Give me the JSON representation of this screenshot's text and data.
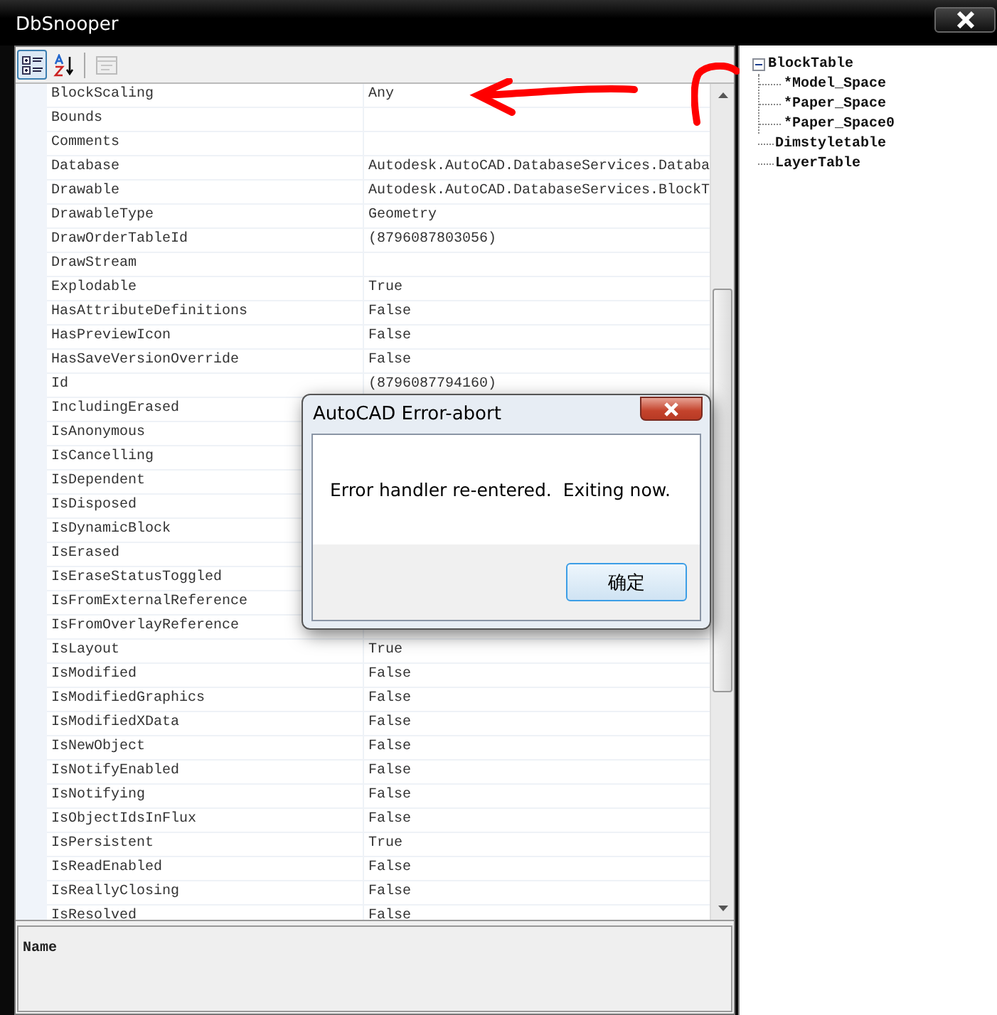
{
  "window": {
    "title": "DbSnooper"
  },
  "toolbar": [
    {
      "kind": "categorized",
      "selected": true,
      "disabled": false
    },
    {
      "kind": "alphabetical",
      "selected": false,
      "disabled": false
    },
    {
      "kind": "pages",
      "selected": false,
      "disabled": true
    }
  ],
  "properties": [
    {
      "name": "BlockScaling",
      "value": "Any"
    },
    {
      "name": "Bounds"
    },
    {
      "name": "Comments"
    },
    {
      "name": "Database",
      "value": "Autodesk.AutoCAD.DatabaseServices.Databa"
    },
    {
      "name": "Drawable",
      "value": "Autodesk.AutoCAD.DatabaseServices.BlockT"
    },
    {
      "name": "DrawableType",
      "value": "Geometry"
    },
    {
      "name": "DrawOrderTableId",
      "value": "(8796087803056)"
    },
    {
      "name": "DrawStream"
    },
    {
      "name": "Explodable",
      "value": "True"
    },
    {
      "name": "HasAttributeDefinitions",
      "value": "False"
    },
    {
      "name": "HasPreviewIcon",
      "value": "False"
    },
    {
      "name": "HasSaveVersionOverride",
      "value": "False"
    },
    {
      "name": "Id",
      "value": "(8796087794160)"
    },
    {
      "name": "IncludingErased"
    },
    {
      "name": "IsAnonymous"
    },
    {
      "name": "IsCancelling"
    },
    {
      "name": "IsDependent"
    },
    {
      "name": "IsDisposed"
    },
    {
      "name": "IsDynamicBlock"
    },
    {
      "name": "IsErased"
    },
    {
      "name": "IsEraseStatusToggled"
    },
    {
      "name": "IsFromExternalReference"
    },
    {
      "name": "IsFromOverlayReference"
    },
    {
      "name": "IsLayout",
      "value": "True"
    },
    {
      "name": "IsModified",
      "value": "False"
    },
    {
      "name": "IsModifiedGraphics",
      "value": "False"
    },
    {
      "name": "IsModifiedXData",
      "value": "False"
    },
    {
      "name": "IsNewObject",
      "value": "False"
    },
    {
      "name": "IsNotifyEnabled",
      "value": "False"
    },
    {
      "name": "IsNotifying",
      "value": "False"
    },
    {
      "name": "IsObjectIdsInFlux",
      "value": "False"
    },
    {
      "name": "IsPersistent",
      "value": "True"
    },
    {
      "name": "IsReadEnabled",
      "value": "False"
    },
    {
      "name": "IsReallyClosing",
      "value": "False"
    },
    {
      "name": "IsResolved",
      "value": "False"
    }
  ],
  "description": {
    "title": "Name"
  },
  "tree": [
    {
      "label": "BlockTable",
      "expanded": true,
      "children": [
        {
          "label": "*Model_Space"
        },
        {
          "label": "*Paper_Space"
        },
        {
          "label": "*Paper_Space0"
        }
      ]
    },
    {
      "label": "Dimstyletable"
    },
    {
      "label": "LayerTable"
    }
  ],
  "dialog": {
    "title": "AutoCAD Error-abort",
    "message": "Error handler re-entered.  Exiting now.",
    "buttons": [
      "确定"
    ]
  }
}
